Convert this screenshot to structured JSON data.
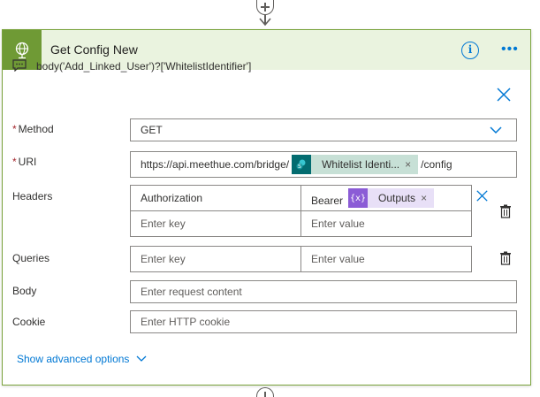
{
  "action": {
    "title": "Get Config New",
    "expression": "body('Add_Linked_User')?['WhitelistIdentifier']"
  },
  "colors": {
    "accent": "#6f9a35",
    "header_bg": "#eaf3df",
    "link": "#0078d4",
    "required": "#a4262c"
  },
  "icons": {
    "header": "globe-icon",
    "info": "info-icon",
    "more": "more-icon",
    "expression": "comment-icon",
    "close": "close-icon",
    "chevron": "chevron-down-icon",
    "trash": "trash-icon",
    "sharepoint": "sharepoint-icon",
    "expression_token": "expression-icon"
  },
  "fields": {
    "method": {
      "required_mark": "*",
      "label": "Method",
      "value": "GET"
    },
    "uri": {
      "required_mark": "*",
      "label": "URI",
      "prefix": "https://api.meethue.com/bridge/",
      "token_label": "Whitelist Identi...",
      "token_close": "×",
      "suffix": "/config"
    },
    "headers": {
      "label": "Headers",
      "key": "Authorization",
      "value_prefix": "Bearer",
      "token_label": "Outputs",
      "token_close": "×",
      "token_glyph": "{x}",
      "key_placeholder": "Enter key",
      "value_placeholder": "Enter value"
    },
    "queries": {
      "label": "Queries",
      "key_placeholder": "Enter key",
      "value_placeholder": "Enter value"
    },
    "body": {
      "label": "Body",
      "placeholder": "Enter request content"
    },
    "cookie": {
      "label": "Cookie",
      "placeholder": "Enter HTTP cookie"
    }
  },
  "advanced_options": "Show advanced options"
}
